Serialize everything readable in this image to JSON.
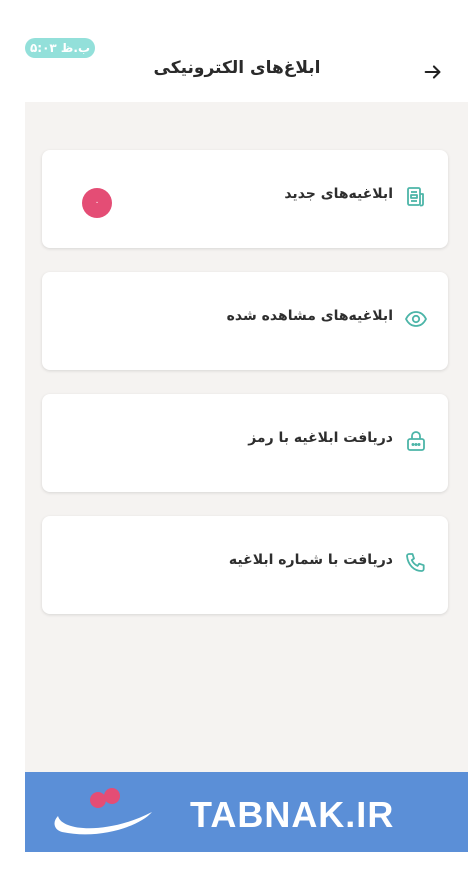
{
  "status_bar": {
    "time": "۵:۰۳ ب.ظ"
  },
  "header": {
    "title": "ابلاغ‌های الکترونیکی",
    "back_icon": "arrow-right-icon"
  },
  "menu": [
    {
      "label": "ابلاغیه‌های جدید",
      "icon": "document-icon",
      "badge": "۰"
    },
    {
      "label": "ابلاغیه‌های مشاهده شده",
      "icon": "eye-icon"
    },
    {
      "label": "دریافت ابلاغیه با رمز",
      "icon": "password-lock-icon"
    },
    {
      "label": "دریافت با شماره ابلاغیه",
      "icon": "phone-icon"
    }
  ],
  "banner": {
    "text": "TABNAK.IR",
    "logo": "tabnak-logo"
  },
  "colors": {
    "accent": "#4cb5a8",
    "badge": "#e44d75",
    "time_pill": "#93e0da",
    "banner": "#5b8fd7",
    "background": "#f5f3f1"
  }
}
